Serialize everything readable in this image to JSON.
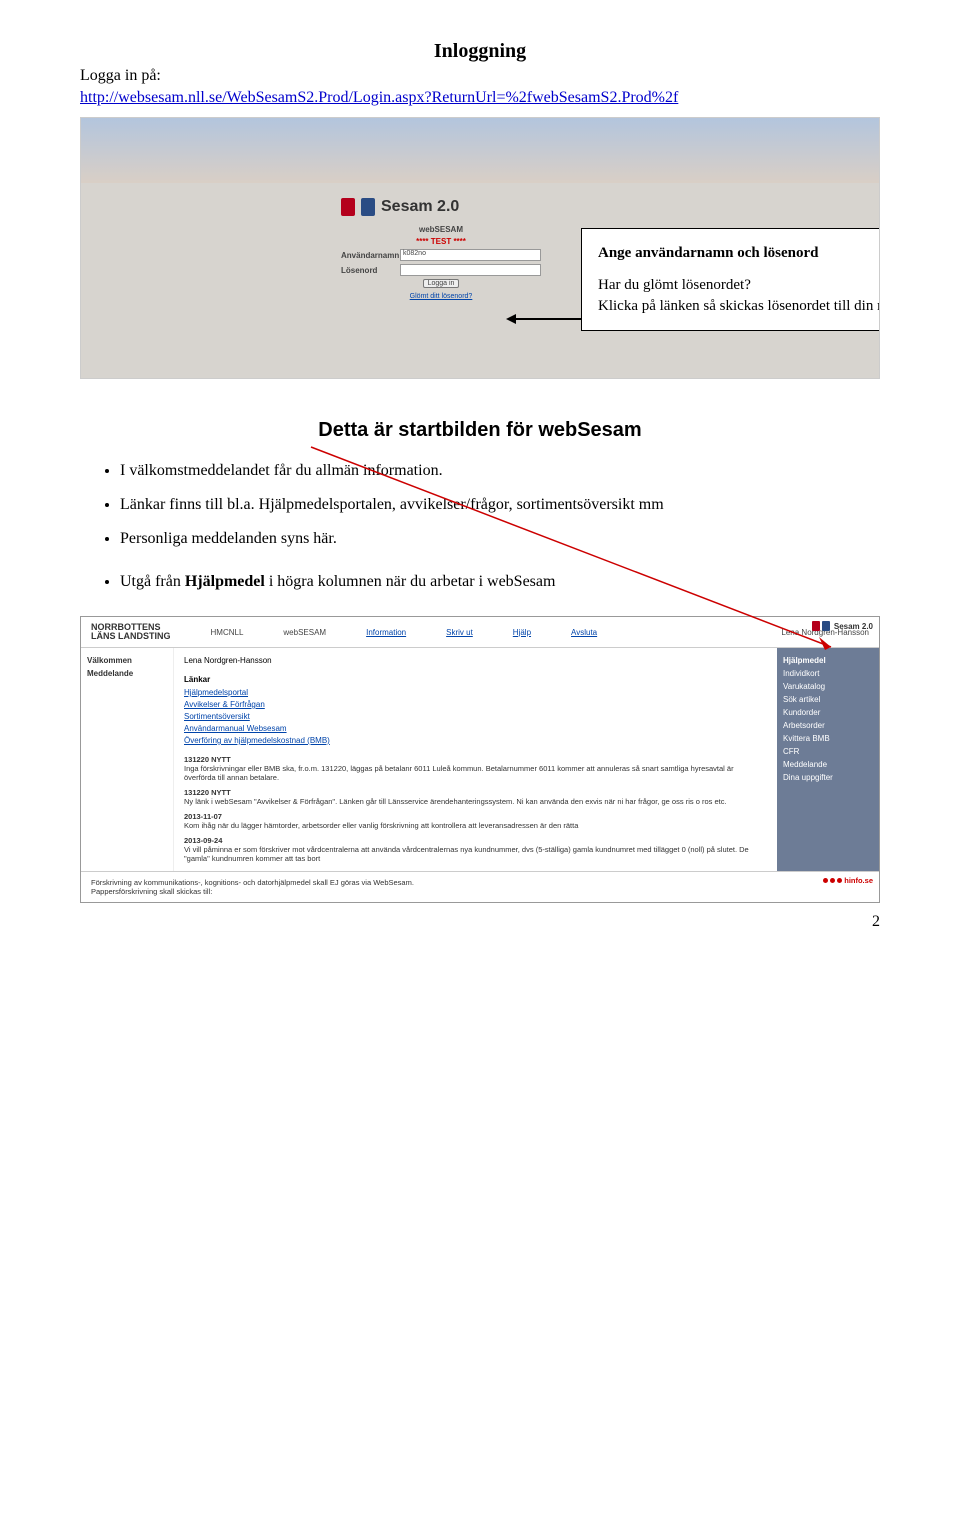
{
  "title": "Inloggning",
  "intro": "Logga in på:",
  "login_url": "http://websesam.nll.se/WebSesamS2.Prod/Login.aspx?ReturnUrl=%2fwebSesamS2.Prod%2f",
  "sesam": {
    "brand": "Sesam 2.0",
    "sub": "webSESAM",
    "test": "**** TEST ****",
    "field_user": "Användarnamn",
    "field_pass": "Lösenord",
    "user_val": "k082no",
    "btn": "Logga in",
    "forgot": "Glömt ditt lösenord?"
  },
  "callout": {
    "head": "Ange användarnamn och lösenord",
    "p1": "Har du glömt lösenordet?",
    "p2": "Klicka på länken så skickas lösenordet till din mail"
  },
  "section2": "Detta är startbilden för webSesam",
  "bullets": [
    "I välkomstmeddelandet får du allmän information.",
    "Länkar finns till bl.a. Hjälpmedelsportalen, avvikelser/frågor, sortimentsöversikt mm",
    "Personliga meddelanden syns här."
  ],
  "utga": {
    "pre": "Utgå från ",
    "bold": "Hjälpmedel",
    "post": " i högra kolumnen när du arbetar i webSesam"
  },
  "s2": {
    "logo_top": "NORRBOTTENS",
    "logo_bot": "LÄNS LANDSTING",
    "hmcnll": "HMCNLL",
    "websesam": "webSESAM",
    "nav_info": "Information",
    "nav_print": "Skriv ut",
    "nav_help": "Hjälp",
    "nav_exit": "Avsluta",
    "user": "Lena Nordgren-Hansson",
    "left_welcome": "Välkommen",
    "left_msg": "Meddelande",
    "links_head": "Länkar",
    "links": [
      "Hjälpmedelsportal",
      "Avvikelser & Förfrågan",
      "Sortimentsöversikt",
      "Användarmanual Websesam",
      "Överföring av hjälpmedelskostnad (BMB)"
    ],
    "news": [
      {
        "t": "131220 NYTT",
        "b": "Inga förskrivningar eller BMB ska, fr.o.m. 131220, läggas på betalanr 6011 Luleå kommun. Betalarnummer 6011 kommer att annuleras så snart samtliga hyresavtal är överförda till annan betalare."
      },
      {
        "t": "131220 NYTT",
        "b": "Ny länk i webSesam \"Avvikelser & Förfrågan\". Länken går till Länsservice ärendehanteringssystem. Ni kan använda den exvis när ni har frågor, ge oss ris o ros etc."
      },
      {
        "t": "2013-11-07",
        "b": "Kom ihåg när du lägger hämtorder, arbetsorder eller vanlig förskrivning att kontrollera att leveransadressen är den rätta"
      },
      {
        "t": "2013-09-24",
        "b": "Vi vill påminna er som förskriver mot vårdcentralerna att använda vårdcentralernas nya kundnummer, dvs (5-ställiga) gamla kundnumret med tillägget 0 (noll) på slutet. De \"gamla\" kundnumren kommer att tas bort"
      }
    ],
    "right": [
      "Hjälpmedel",
      "Individkort",
      "Varukatalog",
      "Sök artikel",
      "Kundorder",
      "Arbetsorder",
      "Kvittera BMB",
      "CFR",
      "Meddelande",
      "Dina uppgifter"
    ],
    "footer1": "Förskrivning av kommunikations-, kognitions- och datorhjälpmedel skall EJ göras via WebSesam.",
    "footer2": "Pappersförskrivning skall skickas till:",
    "hinfo": "hinfo.se"
  },
  "page_num": "2"
}
